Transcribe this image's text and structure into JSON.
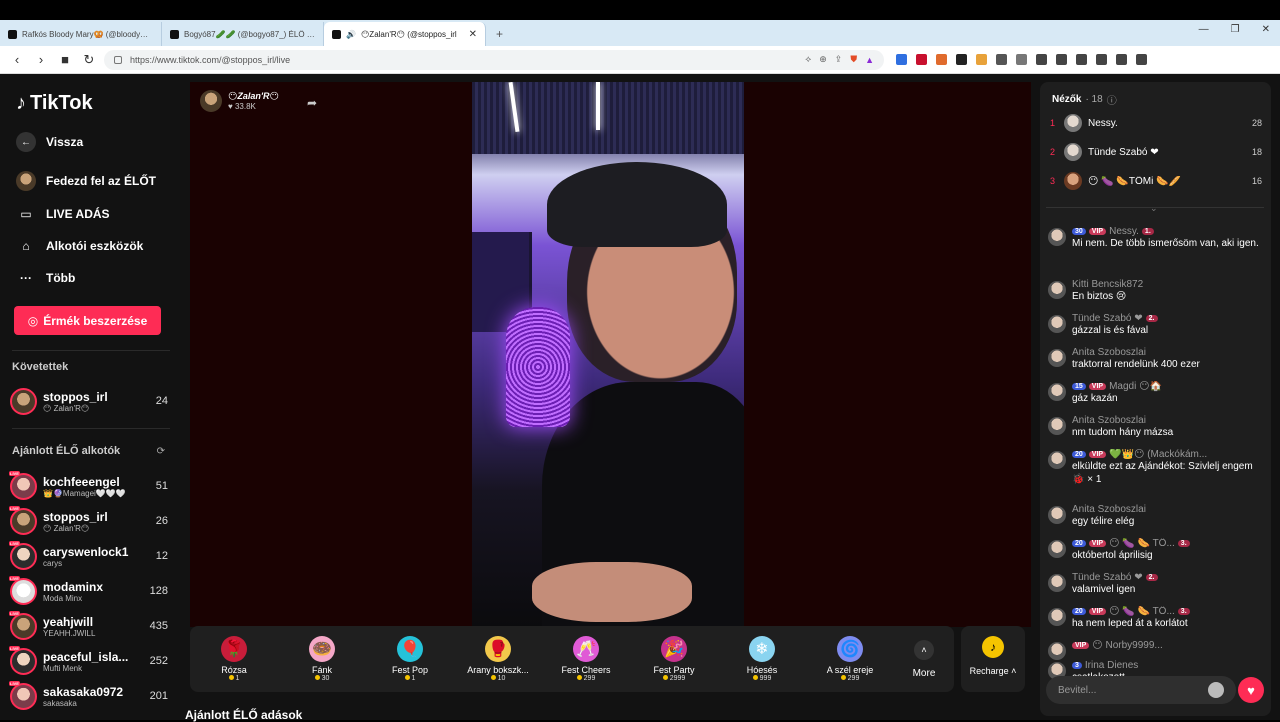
{
  "browser": {
    "tabs": [
      {
        "title": "Rafkós Bloody Mary🥨 (@bloodyma..."
      },
      {
        "title": "Bogyó87🥒🥒 (@bogyo87_) ÉLŐ a..."
      },
      {
        "title": "😶Zalan'R😶 (@stoppos_irl"
      }
    ],
    "url": "https://www.tiktok.com/@stoppos_irl/live"
  },
  "sidebar": {
    "logo": "TikTok",
    "back": "Vissza",
    "nav": [
      {
        "label": "Fedezd fel az ÉLŐT"
      },
      {
        "label": "LIVE ADÁS"
      },
      {
        "label": "Alkotói eszközök"
      },
      {
        "label": "Több"
      }
    ],
    "buy_button": "Érmék beszerzése",
    "following_title": "Követettek",
    "following": [
      {
        "name": "stoppos_irl",
        "sub": "😶 Zalan'R😶",
        "count": "24"
      }
    ],
    "recommended_title": "Ajánlott ÉLŐ alkotók",
    "recommended": [
      {
        "name": "kochfeeengel",
        "sub": "👑🔮Mamagei🤍🤍🤍",
        "count": "51"
      },
      {
        "name": "stoppos_irl",
        "sub": "😶 Zalan'R😶",
        "count": "26"
      },
      {
        "name": "caryswenlock1",
        "sub": "carys",
        "count": "12"
      },
      {
        "name": "modaminx",
        "sub": "Moda Minx",
        "count": "128"
      },
      {
        "name": "yeahjwill",
        "sub": "YEAHH.JWILL",
        "count": "435"
      },
      {
        "name": "peaceful_isla...",
        "sub": "Mufti Menk",
        "count": "252"
      },
      {
        "name": "sakasaka0972",
        "sub": "sakasaka",
        "count": "201"
      }
    ]
  },
  "stage": {
    "host_name": "😶Zalan'R😶",
    "host_likes": "♥ 33.8K",
    "gifts": [
      {
        "name": "Rózsa",
        "price": "1",
        "icon": "🌹",
        "color": "#c81d3a"
      },
      {
        "name": "Fánk",
        "price": "30",
        "icon": "🍩",
        "color": "#f4a7c7"
      },
      {
        "name": "Fest Pop",
        "price": "1",
        "icon": "🎈",
        "color": "#25c2d9"
      },
      {
        "name": "Arany bokszk...",
        "price": "10",
        "icon": "🥊",
        "color": "#f2c84b"
      },
      {
        "name": "Fest Cheers",
        "price": "299",
        "icon": "🥂",
        "color": "#e05ad6"
      },
      {
        "name": "Fest Party",
        "price": "2999",
        "icon": "🎉",
        "color": "#c5328c"
      },
      {
        "name": "Hóesés",
        "price": "999",
        "icon": "❄",
        "color": "#8ad4f0"
      },
      {
        "name": "A szél ereje",
        "price": "299",
        "icon": "🌀",
        "color": "#7e8cf0"
      }
    ],
    "more": "More",
    "recharge": "Recharge",
    "recommended_heading": "Ajánlott ÉLŐ adások"
  },
  "chat": {
    "viewers_label": "Nézők",
    "viewers_count": "· 18",
    "top_viewers": [
      {
        "rank": "1",
        "name": "Nessy.",
        "score": "28"
      },
      {
        "rank": "2",
        "name": "Tünde Szabó ❤",
        "score": "18"
      },
      {
        "rank": "3",
        "name": "😶 🍆 🌭TÖMi 🌭🥖",
        "score": "16"
      }
    ],
    "messages": [
      {
        "user": "Nessy.",
        "lvl": "30",
        "vip": "VIP",
        "fan": "1.",
        "text": "Mi nem. De több ismerősöm van, aki igen."
      },
      {
        "user": "Kitti Bencsik872",
        "lvl": "",
        "vip": "",
        "fan": "",
        "text": "En biztos 😢"
      },
      {
        "user": "Tünde Szabó ❤",
        "lvl": "",
        "vip": "",
        "fan": "2.",
        "text": "gázzal is és fával"
      },
      {
        "user": "Anita Szoboszlai",
        "lvl": "",
        "vip": "",
        "fan": "",
        "text": "traktorral rendelünk 400 ezer"
      },
      {
        "user": "Magdi 😶🏠",
        "lvl": "15",
        "vip": "VIP",
        "fan": "",
        "text": "gáz kazán"
      },
      {
        "user": "Anita Szoboszlai",
        "lvl": "",
        "vip": "",
        "fan": "",
        "text": "nm tudom hány mázsa"
      },
      {
        "user": "💚👑😶 (Mackókám...",
        "lvl": "20",
        "vip": "VIP",
        "fan": "",
        "text": "elküldte ezt az Ajándékot: Szivlelj engem 🐞 × 1"
      },
      {
        "user": "Anita Szoboszlai",
        "lvl": "",
        "vip": "",
        "fan": "",
        "text": "egy télire elég"
      },
      {
        "user": "😶 🍆 🌭 TÖ...",
        "lvl": "20",
        "vip": "VIP",
        "fan": "3.",
        "text": "októbertol áprilisig"
      },
      {
        "user": "Tünde Szabó ❤",
        "lvl": "",
        "vip": "",
        "fan": "2.",
        "text": "valamivel igen"
      },
      {
        "user": "😶 🍆 🌭 TÖ...",
        "lvl": "20",
        "vip": "VIP",
        "fan": "3.",
        "text": "ha nem leped át a korlátot"
      },
      {
        "user": "😶 Norby9999...",
        "lvl": "",
        "vip": "VIP",
        "fan": "",
        "text": ""
      },
      {
        "user": "Irina Dienes",
        "lvl": "3",
        "vip": "",
        "fan": "",
        "text": "csatlakozott"
      }
    ],
    "input_placeholder": "Bevitel..."
  }
}
